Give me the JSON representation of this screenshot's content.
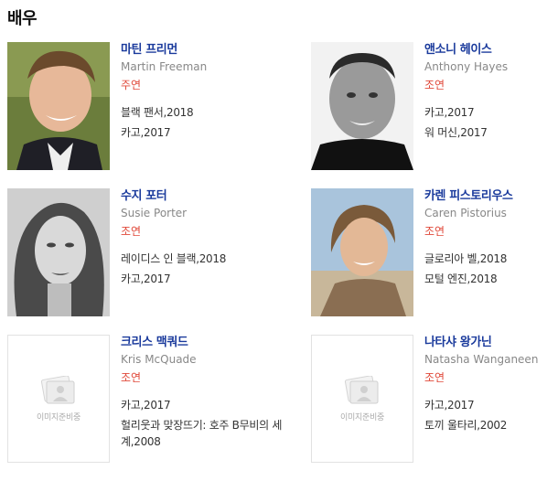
{
  "section_title": "배우",
  "placeholder_text": "이미지준비중",
  "colors": {
    "name": "#1a3a9c",
    "role": "#e0493a",
    "english_name": "#888888"
  },
  "actors": [
    {
      "name": "마틴 프리먼",
      "english_name": "Martin Freeman",
      "role": "주연",
      "has_photo": true,
      "works": [
        "블랙 팬서,2018",
        "카고,2017"
      ]
    },
    {
      "name": "앤소니 헤이스",
      "english_name": "Anthony Hayes",
      "role": "조연",
      "has_photo": true,
      "works": [
        "카고,2017",
        "워 머신,2017"
      ]
    },
    {
      "name": "수지 포터",
      "english_name": "Susie Porter",
      "role": "조연",
      "has_photo": true,
      "works": [
        "레이디스 인 블랙,2018",
        "카고,2017"
      ]
    },
    {
      "name": "카렌 피스토리우스",
      "english_name": "Caren Pistorius",
      "role": "조연",
      "has_photo": true,
      "works": [
        "글로리아 벨,2018",
        "모털 엔진,2018"
      ]
    },
    {
      "name": "크리스 맥쿼드",
      "english_name": "Kris McQuade",
      "role": "조연",
      "has_photo": false,
      "works": [
        "카고,2017",
        "헐리웃과 맞장뜨기: 호주 B무비의 세계,2008"
      ]
    },
    {
      "name": "나타샤 왕가닌",
      "english_name": "Natasha Wanganeen",
      "role": "조연",
      "has_photo": false,
      "works": [
        "카고,2017",
        "토끼 울타리,2002"
      ]
    }
  ]
}
